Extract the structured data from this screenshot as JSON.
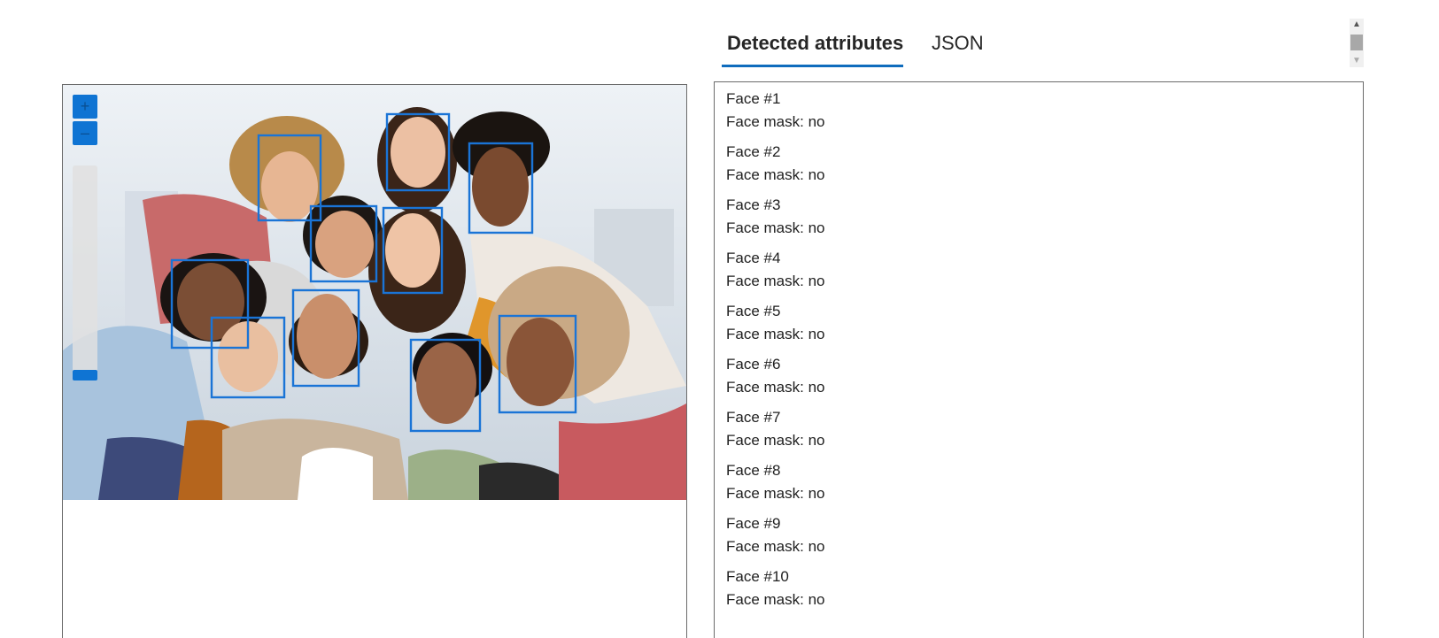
{
  "viewer": {
    "zoom_in_label": "+",
    "zoom_out_label": "–",
    "image_alt": "Group of smiling friends with detected faces outlined",
    "box_color": "#1a74d6"
  },
  "tabs": [
    {
      "label": "Detected attributes",
      "active": true
    },
    {
      "label": "JSON",
      "active": false
    }
  ],
  "scroll_up_icon": "chevron-up-icon",
  "scroll_down_icon": "chevron-down-icon",
  "results": [
    {
      "title": "Face #1",
      "mask": "Face mask: no"
    },
    {
      "title": "Face #2",
      "mask": "Face mask: no"
    },
    {
      "title": "Face #3",
      "mask": "Face mask: no"
    },
    {
      "title": "Face #4",
      "mask": "Face mask: no"
    },
    {
      "title": "Face #5",
      "mask": "Face mask: no"
    },
    {
      "title": "Face #6",
      "mask": "Face mask: no"
    },
    {
      "title": "Face #7",
      "mask": "Face mask: no"
    },
    {
      "title": "Face #8",
      "mask": "Face mask: no"
    },
    {
      "title": "Face #9",
      "mask": "Face mask: no"
    },
    {
      "title": "Face #10",
      "mask": "Face mask: no"
    }
  ],
  "colors": {
    "accent": "#0f6cbd",
    "zoom_button": "#0f74d3",
    "border": "#6b6b6b"
  }
}
